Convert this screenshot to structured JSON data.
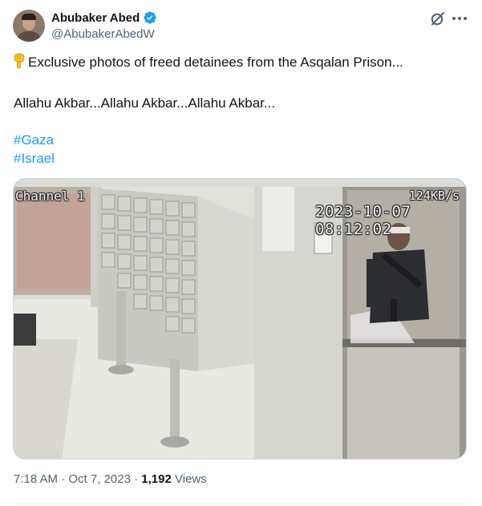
{
  "author": {
    "display_name": "Abubaker Abed",
    "handle": "@AbubakerAbedW",
    "verified": true
  },
  "tweet": {
    "lines": [
      "Exclusive photos of freed detainees from the Asqalan Prison...",
      "Allahu Akbar...Allahu Akbar...Allahu Akbar..."
    ],
    "emoji": "pointing-down-emoji",
    "hashtags": [
      "#Gaza",
      "#Israel"
    ]
  },
  "media": {
    "channel_label": "Channel 1",
    "bitrate": "124KB/s",
    "timestamp": "2023-10-07 08:12:02"
  },
  "footer": {
    "time": "7:18 AM",
    "separator": "·",
    "date": "Oct 7, 2023",
    "views_count": "1,192",
    "views_label": "Views"
  },
  "icons": {
    "verified": "verified-badge-icon",
    "grok": "grok-icon",
    "more": "more-options-icon"
  },
  "colors": {
    "accent": "#1d9bf0",
    "text_primary": "#0f1419",
    "text_secondary": "#536471"
  }
}
